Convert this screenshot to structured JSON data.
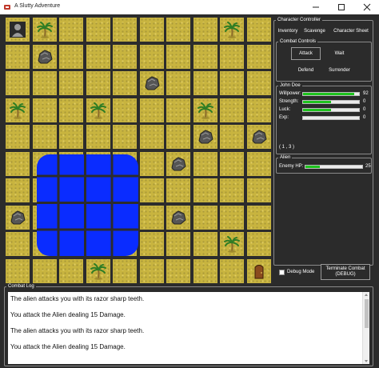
{
  "window": {
    "title": "A Slutty Adventure",
    "accent": "#c0392b"
  },
  "board": {
    "rows": 10,
    "cols": 10,
    "tile_color": "#c8b43f",
    "water_color": "#0a2cff",
    "entities": [
      {
        "kind": "player",
        "icon": "player-icon",
        "row": 0,
        "col": 0
      },
      {
        "kind": "palm",
        "icon": "palm-tree-icon",
        "row": 0,
        "col": 1
      },
      {
        "kind": "palm",
        "icon": "palm-tree-icon",
        "row": 0,
        "col": 8
      },
      {
        "kind": "rock",
        "icon": "rock-icon",
        "row": 1,
        "col": 1
      },
      {
        "kind": "rock",
        "icon": "rock-icon",
        "row": 2,
        "col": 5
      },
      {
        "kind": "palm",
        "icon": "palm-tree-icon",
        "row": 3,
        "col": 0
      },
      {
        "kind": "palm",
        "icon": "palm-tree-icon",
        "row": 3,
        "col": 3
      },
      {
        "kind": "palm",
        "icon": "palm-tree-icon",
        "row": 3,
        "col": 7
      },
      {
        "kind": "rock",
        "icon": "rock-icon",
        "row": 4,
        "col": 7
      },
      {
        "kind": "rock",
        "icon": "rock-icon",
        "row": 4,
        "col": 9
      },
      {
        "kind": "rock",
        "icon": "rock-icon",
        "row": 5,
        "col": 6
      },
      {
        "kind": "rock",
        "icon": "rock-icon",
        "row": 7,
        "col": 0
      },
      {
        "kind": "rock",
        "icon": "rock-icon",
        "row": 7,
        "col": 6
      },
      {
        "kind": "palm",
        "icon": "palm-tree-icon",
        "row": 8,
        "col": 8
      },
      {
        "kind": "palm",
        "icon": "palm-tree-icon",
        "row": 9,
        "col": 3
      },
      {
        "kind": "door",
        "icon": "door-icon",
        "row": 9,
        "col": 9
      }
    ]
  },
  "character_controller": {
    "title": "Character Controller",
    "tabs": [
      "Inventory",
      "Scavenge",
      "Character Sheet"
    ],
    "combat": {
      "title": "Combat Controls",
      "attack": "Attack",
      "wait": "Wait",
      "defend": "Defend",
      "surrender": "Surrender"
    }
  },
  "player": {
    "name": "John Doe",
    "stats": [
      {
        "label": "Willpower:",
        "value": "92",
        "fraction": 0.92
      },
      {
        "label": "Strength:",
        "value": "0",
        "fraction": 0.5
      },
      {
        "label": "Luck:",
        "value": "0",
        "fraction": 0.5
      },
      {
        "label": "Exp:",
        "value": "0",
        "fraction": 0
      }
    ],
    "position": "( 1 , 3 )"
  },
  "enemy": {
    "name": "Alien",
    "hp_label": "Enemy HP:",
    "hp_value": "25",
    "hp_fraction": 0.25
  },
  "debug": {
    "mode_label": "Debug Mode",
    "mode_checked": false,
    "terminate_label": "Terminate Combat",
    "terminate_sub": "(DEBUG)"
  },
  "combat_log": {
    "title": "Combat Log",
    "lines": [
      "The alien attacks you with its razor sharp teeth.",
      "You attack the Alien dealing 15 Damage.",
      "The alien attacks you with its razor sharp teeth.",
      "You attack the Alien dealing 15 Damage."
    ]
  },
  "colors": {
    "bar_fill": "#1ec41e",
    "panel_bg": "#2b2b2b"
  }
}
